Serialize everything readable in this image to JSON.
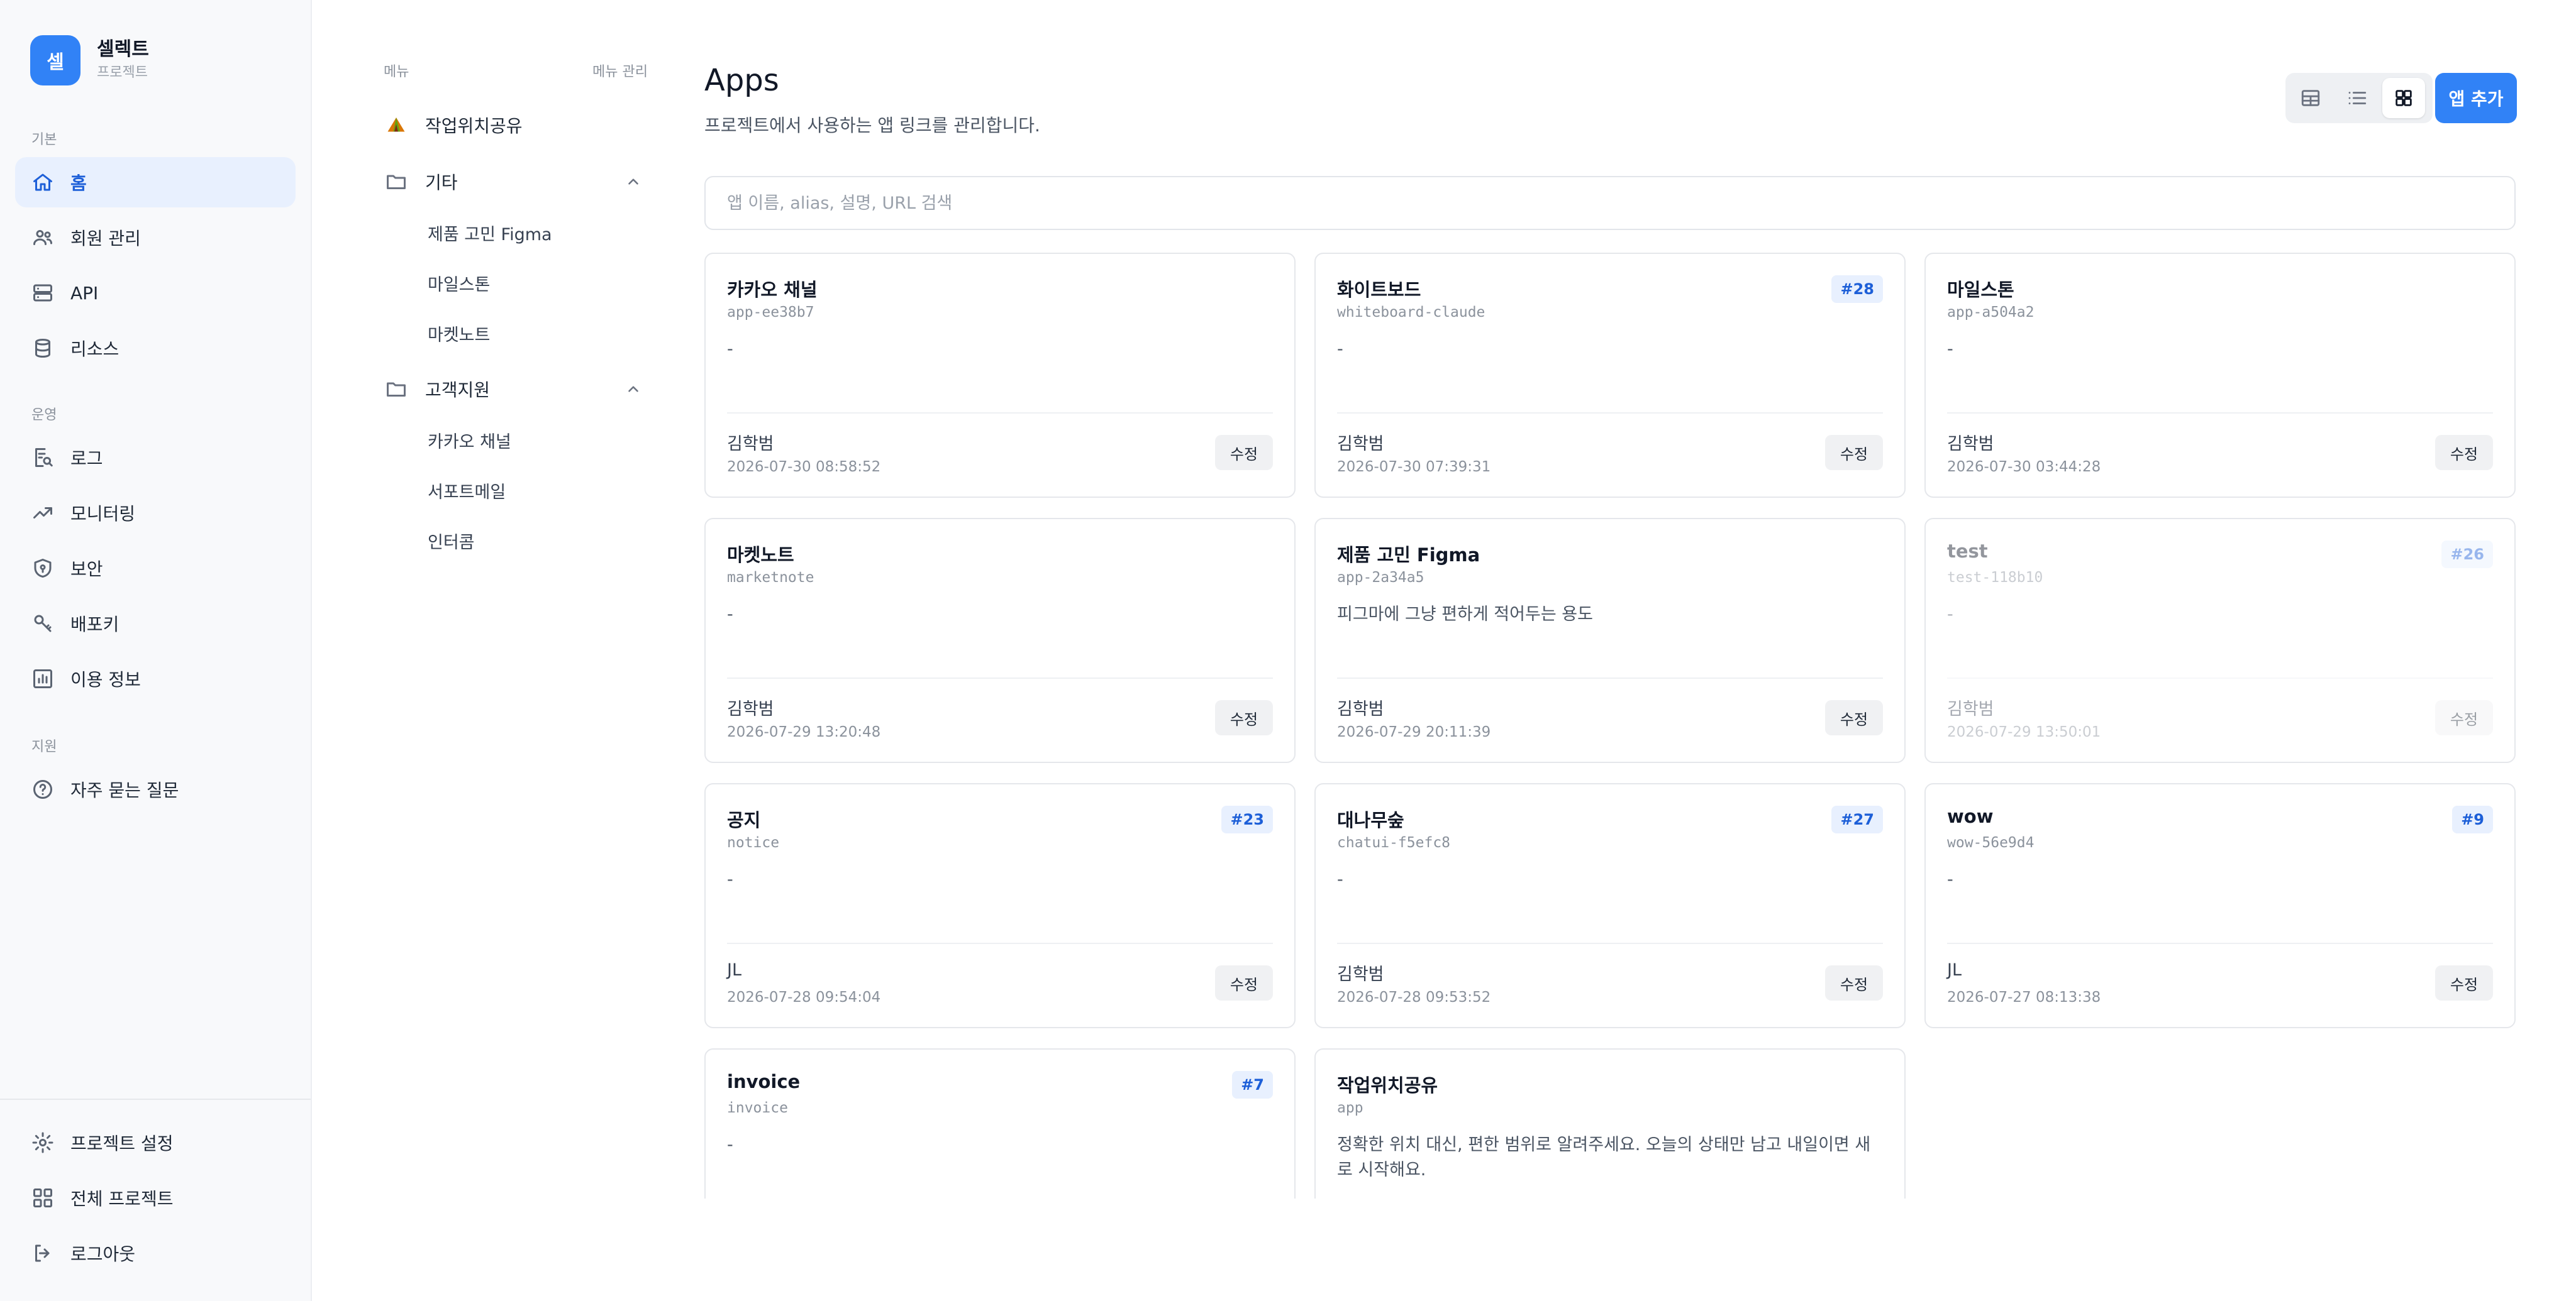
{
  "brand": {
    "logo_char": "셀",
    "name": "셀렉트",
    "sub": "프로젝트",
    "accent": "#3182f6"
  },
  "sidebar": {
    "sections": [
      {
        "label": "기본",
        "items": [
          {
            "label": "홈",
            "icon": "home-icon",
            "active": true
          },
          {
            "label": "회원 관리",
            "icon": "users-icon"
          },
          {
            "label": "API",
            "icon": "server-icon"
          },
          {
            "label": "리소스",
            "icon": "database-icon"
          }
        ]
      },
      {
        "label": "운영",
        "items": [
          {
            "label": "로그",
            "icon": "log-search-icon"
          },
          {
            "label": "모니터링",
            "icon": "trend-icon"
          },
          {
            "label": "보안",
            "icon": "shield-icon"
          },
          {
            "label": "배포키",
            "icon": "key-icon"
          },
          {
            "label": "이용 정보",
            "icon": "bar-chart-icon"
          }
        ]
      },
      {
        "label": "지원",
        "items": [
          {
            "label": "자주 묻는 질문",
            "icon": "help-circle-icon"
          }
        ]
      }
    ],
    "bottom": [
      {
        "label": "프로젝트 설정",
        "icon": "gear-icon"
      },
      {
        "label": "전체 프로젝트",
        "icon": "grid-icon"
      },
      {
        "label": "로그아웃",
        "icon": "logout-icon"
      }
    ]
  },
  "menu": {
    "header_label": "메뉴",
    "manage_label": "메뉴 관리",
    "top_item": {
      "label": "작업위치공유",
      "icon": "tent-icon"
    },
    "folders": [
      {
        "label": "기타",
        "icon": "folder-icon",
        "expanded": true,
        "children": [
          "제품 고민 Figma",
          "마일스톤",
          "마켓노트"
        ]
      },
      {
        "label": "고객지원",
        "icon": "folder-icon",
        "expanded": true,
        "children": [
          "카카오 채널",
          "서포트메일",
          "인터콤"
        ]
      }
    ]
  },
  "main": {
    "title": "Apps",
    "subtitle": "프로젝트에서 사용하는 앱 링크를 관리합니다.",
    "add_button": "앱 추가",
    "view_modes": [
      "table-view-icon",
      "list-view-icon",
      "card-view-icon"
    ],
    "active_view": "card-view-icon",
    "search_placeholder": "앱 이름, alias, 설명, URL 검색",
    "edit_label": "수정",
    "apps": [
      {
        "name": "카카오 채널",
        "slug": "app-ee38b7",
        "badge": "",
        "desc": "-",
        "author": "김학범",
        "date": "2026-07-30 08:58:52",
        "dim": false
      },
      {
        "name": "화이트보드",
        "slug": "whiteboard-claude",
        "badge": "#28",
        "desc": "-",
        "author": "김학범",
        "date": "2026-07-30 07:39:31",
        "dim": false
      },
      {
        "name": "마일스톤",
        "slug": "app-a504a2",
        "badge": "",
        "desc": "-",
        "author": "김학범",
        "date": "2026-07-30 03:44:28",
        "dim": false
      },
      {
        "name": "마켓노트",
        "slug": "marketnote",
        "badge": "",
        "desc": "-",
        "author": "김학범",
        "date": "2026-07-29 13:20:48",
        "dim": false
      },
      {
        "name": "제품 고민 Figma",
        "slug": "app-2a34a5",
        "badge": "",
        "desc": "피그마에 그냥 편하게 적어두는 용도",
        "author": "김학범",
        "date": "2026-07-29 20:11:39",
        "dim": false
      },
      {
        "name": "test",
        "slug": "test-118b10",
        "badge": "#26",
        "desc": "-",
        "author": "김학범",
        "date": "2026-07-29 13:50:01",
        "dim": true
      },
      {
        "name": "공지",
        "slug": "notice",
        "badge": "#23",
        "desc": "-",
        "author": "JL",
        "date": "2026-07-28 09:54:04",
        "dim": false
      },
      {
        "name": "대나무숲",
        "slug": "chatui-f5efc8",
        "badge": "#27",
        "desc": "-",
        "author": "김학범",
        "date": "2026-07-28 09:53:52",
        "dim": false
      },
      {
        "name": "wow",
        "slug": "wow-56e9d4",
        "badge": "#9",
        "desc": "-",
        "author": "JL",
        "date": "2026-07-27 08:13:38",
        "dim": false
      },
      {
        "name": "invoice",
        "slug": "invoice",
        "badge": "#7",
        "desc": "-",
        "author": "",
        "date": "",
        "dim": false
      },
      {
        "name": "작업위치공유",
        "slug": "app",
        "badge": "",
        "desc": "정확한 위치 대신, 편한 범위로 알려주세요. 오늘의 상태만 남고 내일이면 새로 시작해요.",
        "author": "",
        "date": "",
        "dim": false
      }
    ]
  }
}
